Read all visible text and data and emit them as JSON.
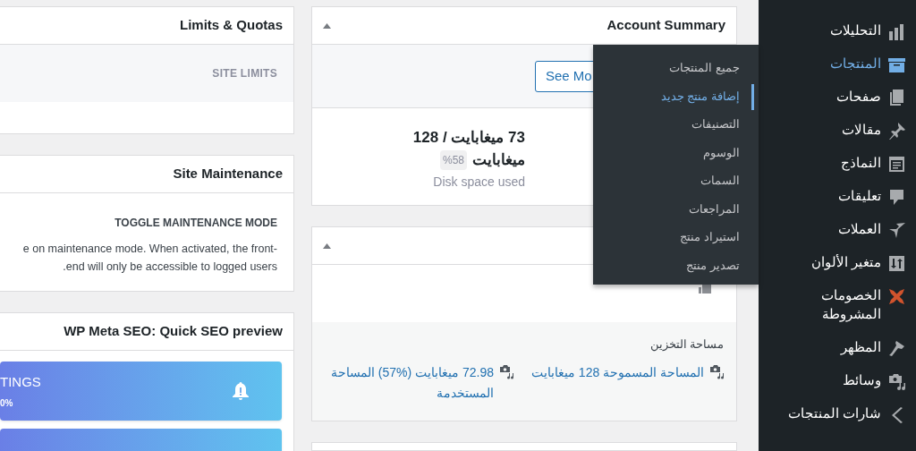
{
  "left_column": {
    "limits_panel": {
      "title": "Limits & Quotas",
      "section": "SITE LIMITS"
    },
    "maintenance_panel": {
      "title": "Site Maintenance",
      "heading": "TOGGLE MAINTENANCE MODE",
      "lines": [
        "e on maintenance mode. When activated, the front-",
        ".end will only be accessible to logged users"
      ]
    },
    "seo_panel": {
      "title": "WP Meta SEO: Quick SEO preview",
      "cards": [
        {
          "title": "TINGS",
          "value": "0%"
        }
      ]
    }
  },
  "middle_column": {
    "account_summary": {
      "title": "Account Summary",
      "button": "See Mo",
      "usage_lines": [
        "73 ميغابايت / 128",
        "ميغابايت"
      ],
      "percent_badge": "%58",
      "caption": "Disk space used"
    },
    "storage_panel": {
      "section_title": "مساحة التخزين",
      "items": [
        {
          "text": "المساحة المسموحة 128 ميغابايت"
        },
        {
          "text": "72.98 ميغابايت (%57) المساحة المستخدمة"
        }
      ]
    }
  },
  "sidebar": {
    "items": [
      {
        "label": "التحليلات",
        "selected": false
      },
      {
        "label": "المنتجات",
        "selected": true
      },
      {
        "label": "صفحات",
        "selected": false
      },
      {
        "label": "مقالات",
        "selected": false
      },
      {
        "label": "النماذج",
        "selected": false
      },
      {
        "label": "تعليقات",
        "selected": false
      },
      {
        "label": "العملات",
        "selected": false
      },
      {
        "label": "متغير الألوان",
        "selected": false
      },
      {
        "label": "الخصومات المشروطة",
        "selected": false
      },
      {
        "label": "المظهر",
        "selected": false
      },
      {
        "label": "وسائط",
        "selected": false
      },
      {
        "label": "شارات المنتجات",
        "selected": false
      }
    ]
  },
  "flyout_menu": {
    "items": [
      {
        "label": "جميع المنتجات",
        "selected": false
      },
      {
        "label": "إضافة منتج جديد",
        "selected": true
      },
      {
        "label": "التصنيفات",
        "selected": false
      },
      {
        "label": "الوسوم",
        "selected": false
      },
      {
        "label": "السمات",
        "selected": false
      },
      {
        "label": "المراجعات",
        "selected": false
      },
      {
        "label": "استيراد منتج",
        "selected": false
      },
      {
        "label": "تصدير منتج",
        "selected": false
      }
    ]
  }
}
